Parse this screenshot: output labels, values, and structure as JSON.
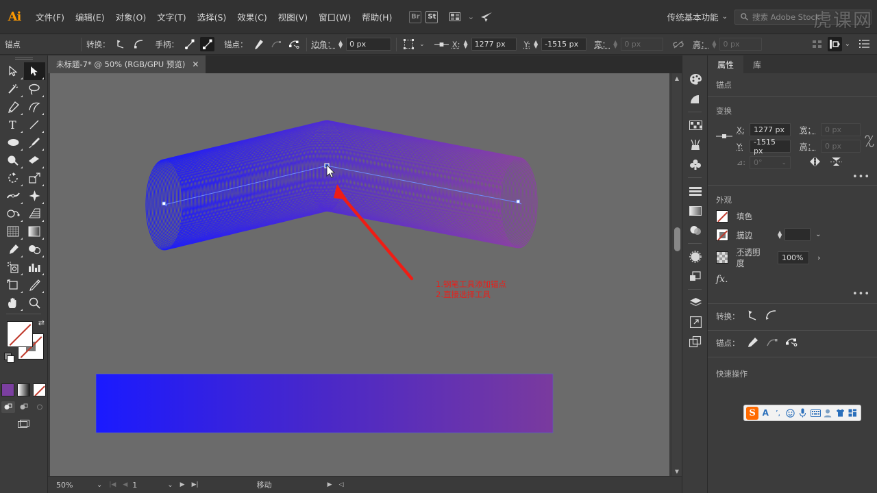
{
  "app": {
    "name": "Adobe Illustrator",
    "logo_text": "Ai"
  },
  "menubar": {
    "items": [
      {
        "label": "文件(F)",
        "name": "menu-file"
      },
      {
        "label": "编辑(E)",
        "name": "menu-edit"
      },
      {
        "label": "对象(O)",
        "name": "menu-object"
      },
      {
        "label": "文字(T)",
        "name": "menu-type"
      },
      {
        "label": "选择(S)",
        "name": "menu-select"
      },
      {
        "label": "效果(C)",
        "name": "menu-effect"
      },
      {
        "label": "视图(V)",
        "name": "menu-view"
      },
      {
        "label": "窗口(W)",
        "name": "menu-window"
      },
      {
        "label": "帮助(H)",
        "name": "menu-help"
      }
    ],
    "bridge_label": "Br",
    "stock_label": "St",
    "arrange_caret": "⌄",
    "workspace": {
      "label": "传统基本功能",
      "caret": "⌄"
    },
    "search": {
      "placeholder": "搜索 Adobe Stock",
      "icon": "search-icon"
    },
    "watermark": "虎课网"
  },
  "controlbar": {
    "selection_label": "锚点",
    "convert_label": "转换：",
    "handles_label": "手柄：",
    "anchor_label": "锚点：",
    "corner_label": "边角：",
    "corner_value": "0 px",
    "x_label": "X:",
    "x_value": "1277 px",
    "y_label": "Y:",
    "y_value": "-1515 px",
    "w_label": "宽：",
    "w_value": "0 px",
    "h_label": "高：",
    "h_value": "0 px",
    "link_icon": "broken-link-icon",
    "align_icon": "align-icon",
    "options_icon": "more-options-icon"
  },
  "toolbar": {
    "tools": [
      {
        "name": "selection-tool",
        "glyph": "selection",
        "selected": false
      },
      {
        "name": "direct-selection-tool",
        "glyph": "direct-selection",
        "selected": true
      },
      {
        "name": "magic-wand-tool",
        "glyph": "magic-wand",
        "selected": false
      },
      {
        "name": "lasso-tool",
        "glyph": "lasso",
        "selected": false
      },
      {
        "name": "pen-tool",
        "glyph": "pen",
        "selected": false
      },
      {
        "name": "curvature-tool",
        "glyph": "curvature",
        "selected": false
      },
      {
        "name": "type-tool",
        "glyph": "type",
        "selected": false
      },
      {
        "name": "line-segment-tool",
        "glyph": "line",
        "selected": false
      },
      {
        "name": "ellipse-tool",
        "glyph": "ellipse",
        "selected": false
      },
      {
        "name": "paintbrush-tool",
        "glyph": "paintbrush",
        "selected": false
      },
      {
        "name": "shaper-tool",
        "glyph": "shaper",
        "selected": false
      },
      {
        "name": "eraser-tool",
        "glyph": "eraser",
        "selected": false
      },
      {
        "name": "rotate-tool",
        "glyph": "rotate",
        "selected": false
      },
      {
        "name": "scale-tool",
        "glyph": "scale",
        "selected": false
      },
      {
        "name": "width-tool",
        "glyph": "width",
        "selected": false
      },
      {
        "name": "free-transform-tool",
        "glyph": "free-transform",
        "selected": false
      },
      {
        "name": "shape-builder-tool",
        "glyph": "shape-builder",
        "selected": false
      },
      {
        "name": "perspective-grid-tool",
        "glyph": "perspective-grid",
        "selected": false
      },
      {
        "name": "mesh-tool",
        "glyph": "mesh",
        "selected": false
      },
      {
        "name": "gradient-tool",
        "glyph": "gradient",
        "selected": false
      },
      {
        "name": "eyedropper-tool",
        "glyph": "eyedropper",
        "selected": false
      },
      {
        "name": "blend-tool",
        "glyph": "blend",
        "selected": false
      },
      {
        "name": "symbol-sprayer-tool",
        "glyph": "symbol-sprayer",
        "selected": false
      },
      {
        "name": "column-graph-tool",
        "glyph": "column-graph",
        "selected": false
      },
      {
        "name": "artboard-tool",
        "glyph": "artboard",
        "selected": false
      },
      {
        "name": "slice-tool",
        "glyph": "slice",
        "selected": false
      },
      {
        "name": "hand-tool",
        "glyph": "hand",
        "selected": false
      },
      {
        "name": "zoom-tool",
        "glyph": "zoom",
        "selected": false
      }
    ],
    "fill_state": "none",
    "stroke_state": "none",
    "color_modes": [
      "color-swatch",
      "gradient-swatch",
      "none-swatch"
    ],
    "draw_modes": [
      "draw-normal",
      "draw-behind",
      "draw-inside"
    ],
    "screen_mode": "change-screen-mode"
  },
  "document": {
    "tab_title": "未标题-7* @ 50% (RGB/GPU 预览)",
    "close_glyph": "✕"
  },
  "statusbar": {
    "zoom": "50%",
    "zoom_caret": "⌄",
    "page": "1",
    "page_caret": "⌄",
    "status_text": "移动",
    "first_glyph": "|◀",
    "prev_glyph": "◀",
    "next_glyph": "▶",
    "last_glyph": "▶|"
  },
  "dock": {
    "icons": [
      "color-panel-icon",
      "color-guide-icon",
      "swatches-icon",
      "brushes-icon",
      "symbols-icon",
      "align-panel-icon",
      "gradient-panel-icon",
      "transparency-icon",
      "stroke-panel-icon",
      "pathfinder-icon",
      "layers-icon",
      "artboards-icon",
      "asset-export-icon"
    ]
  },
  "properties": {
    "tabs": [
      {
        "label": "属性",
        "name": "tab-properties",
        "active": true
      },
      {
        "label": "库",
        "name": "tab-libraries",
        "active": false
      }
    ],
    "selection_title": "锚点",
    "transform": {
      "title": "变换",
      "x_label": "X:",
      "x_value": "1277 px",
      "y_label": "Y:",
      "y_value": "-1515 px",
      "w_label": "宽：",
      "w_value": "0 px",
      "h_label": "高：",
      "h_value": "0 px",
      "angle_label": "⊿:",
      "angle_value": "0°",
      "link_icon": "broken-link-icon",
      "flip_h_icon": "flip-horizontal-icon",
      "flip_v_icon": "flip-vertical-icon",
      "more_icon": "more-options-icon"
    },
    "appearance": {
      "title": "外观",
      "fill_label": "填色",
      "stroke_label": "描边",
      "stroke_weight": "",
      "opacity_label": "不透明度",
      "opacity_value": "100%",
      "fx_label": "fx.",
      "more_icon": "more-options-icon"
    },
    "convert": {
      "label": "转换：",
      "icons": [
        "convert-to-corner-icon",
        "convert-to-smooth-icon"
      ]
    },
    "anchor": {
      "label": "锚点：",
      "icons": [
        "show-handles-icon",
        "hide-handles-icon",
        "remove-anchor-icon"
      ]
    },
    "quick_actions": {
      "title": "快速操作"
    }
  },
  "ime": {
    "name": "sogou-input-toolbar",
    "logo": "S",
    "buttons": [
      "input-mode-A",
      "punctuation-icon",
      "emoji-icon",
      "voice-icon",
      "soft-keyboard-icon",
      "user-icon",
      "skin-icon",
      "toolbox-icon"
    ]
  },
  "artwork": {
    "annotation": {
      "line1": "1.钢笔工具添加锚点",
      "line2": "2.直接选择工具",
      "color": "#e8201b"
    },
    "arrow_color": "#ef1d15",
    "blend_tube": {
      "description": "blend-of-circles-along-bent-path",
      "gradient_start": "#1a1aff",
      "gradient_end": "#8b3fa8"
    },
    "gradient_rect": {
      "start_color": "#1a1aff",
      "end_color": "#7a3a9e"
    },
    "selection_color": "#3a6bff"
  }
}
